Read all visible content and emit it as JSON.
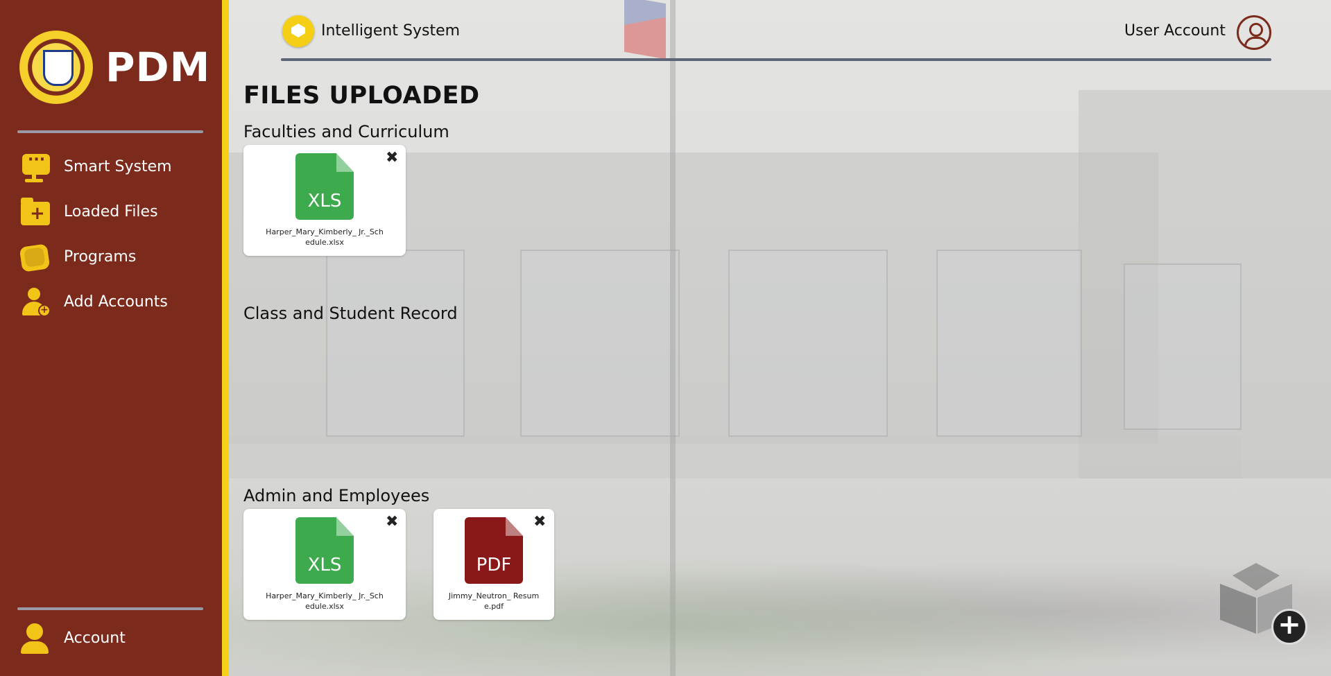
{
  "sidebar": {
    "brand": "PDM",
    "items": [
      {
        "label": "Smart System",
        "icon": "smart-system-icon"
      },
      {
        "label": "Loaded Files",
        "icon": "folder-plus-icon"
      },
      {
        "label": "Programs",
        "icon": "programs-icon"
      },
      {
        "label": "Add Accounts",
        "icon": "add-user-icon"
      }
    ],
    "account_label": "Account",
    "colors": {
      "background": "#7b2a1c",
      "accent": "#f4d21a",
      "icon": "#f2c418"
    }
  },
  "header": {
    "app_title": "Intelligent System",
    "user_label": "User Account"
  },
  "main": {
    "page_title": "FILES UPLOADED",
    "sections": [
      {
        "title": "Faculties and Curriculum",
        "files": [
          {
            "type": "XLS",
            "name": "Harper_Mary_Kimberly_ Jr._Schedule.xlsx",
            "color": "#3daa4d"
          }
        ]
      },
      {
        "title": "Class and Student Record",
        "files": []
      },
      {
        "title": "Admin and Employees",
        "files": [
          {
            "type": "XLS",
            "name": "Harper_Mary_Kimberly_ Jr._Schedule.xlsx",
            "color": "#3daa4d"
          },
          {
            "type": "PDF",
            "name": "Jimmy_Neutron_ Resume.pdf",
            "color": "#8b1818"
          }
        ]
      }
    ],
    "close_glyph": "✖"
  },
  "fab": {
    "icon": "add-cube-icon",
    "plus": "+"
  }
}
